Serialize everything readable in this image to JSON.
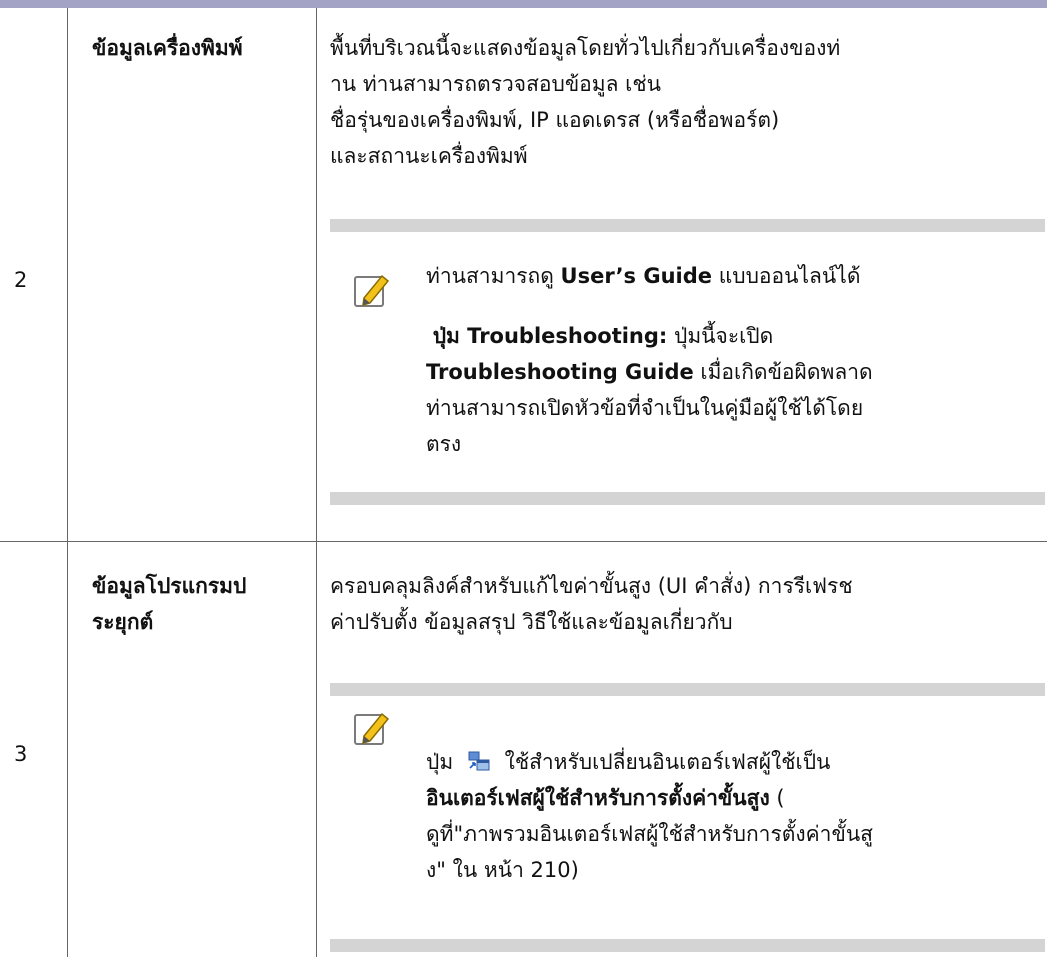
{
  "rows": [
    {
      "number": "2",
      "title": "ข้อมูลเครื่องพิมพ์",
      "description_lines": [
        "พื้นที่บริเวณนี้จะแสดงข้อมูลโดยทั่วไปเกี่ยวกับเครื่องของท่",
        "าน ท่านสามารถตรวจสอบข้อมูล เช่น",
        "ชื่อรุ่นของเครื่องพิมพ์, IP แอดเดรส (หรือชื่อพอร์ต)",
        "และสถานะเครื่องพิมพ์"
      ],
      "note": {
        "icon": "pencil-note-icon",
        "line1_prefix": "ท่านสามารถดู ",
        "line1_bold": "User’s Guide",
        "line1_suffix": " แบบออนไลน์ได้",
        "para2_bold": "ปุ่ม Troubleshooting:",
        "para2_text": " ปุ่มนี้จะเปิด",
        "para2_line2_bold": "Troubleshooting Guide",
        "para2_line2_text": " เมื่อเกิดข้อผิดพลาด",
        "para2_line3": "ท่านสามารถเปิดหัวข้อที่จำเป็นในคู่มือผู้ใช้ได้โดย",
        "para2_line4": "ตรง"
      }
    },
    {
      "number": "3",
      "title_lines": [
        "ข้อมูลโปรแกรมป",
        "ระยุกต์"
      ],
      "description_lines": [
        "ครอบคลุมลิงค์สำหรับแก้ไขค่าขั้นสูง (UI คำสั่ง) การรีเฟรช",
        "ค่าปรับตั้ง ข้อมูลสรุป วิธีใช้และข้อมูลเกี่ยวกับ"
      ],
      "note": {
        "icon": "pencil-note-icon",
        "button_icon": "switch-ui-icon",
        "line1_prefix": "ปุ่ม",
        "line1_suffix": "ใช้สำหรับเปลี่ยนอินเตอร์เฟสผู้ใช้เป็น",
        "line2_bold": "อินเตอร์เฟสผู้ใช้สำหรับการตั้งค่าขั้นสูง",
        "line2_text": " (",
        "line3": "ดูที่\"ภาพรวมอินเตอร์เฟสผู้ใช้สำหรับการตั้งค่าขั้นสู",
        "line4": "ง\"  ใน หน้า 210)"
      }
    }
  ],
  "colors": {
    "header_bar": "#a3a3c6",
    "note_band": "#d4d4d4",
    "rule": "#666666"
  }
}
